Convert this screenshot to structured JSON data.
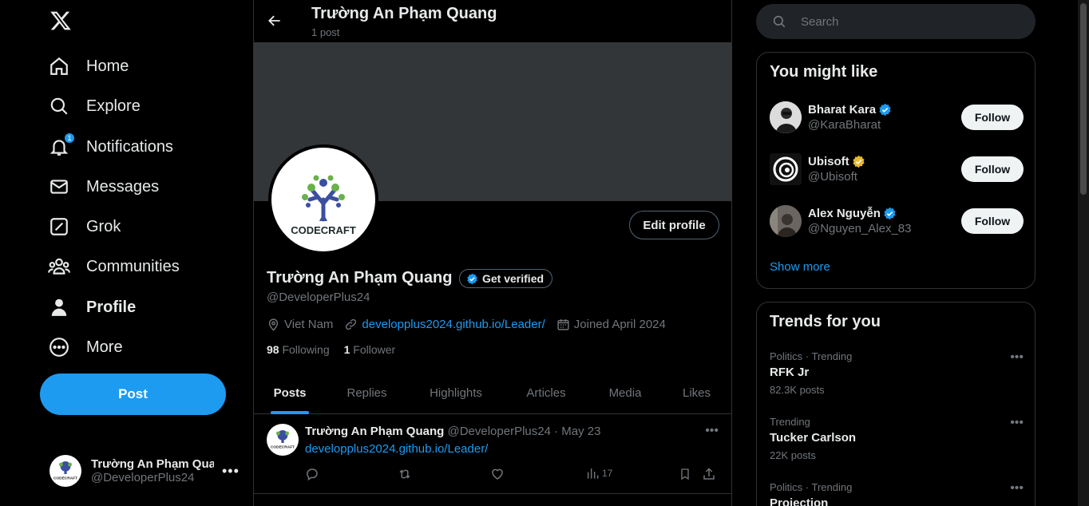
{
  "nav": {
    "items": [
      {
        "label": "Home",
        "icon": "home-icon"
      },
      {
        "label": "Explore",
        "icon": "search-icon"
      },
      {
        "label": "Notifications",
        "icon": "bell-icon",
        "badge": "1"
      },
      {
        "label": "Messages",
        "icon": "envelope-icon"
      },
      {
        "label": "Grok",
        "icon": "grok-icon"
      },
      {
        "label": "Communities",
        "icon": "people-icon"
      },
      {
        "label": "Profile",
        "icon": "person-icon"
      },
      {
        "label": "More",
        "icon": "more-circle-icon"
      }
    ],
    "post_label": "Post",
    "account": {
      "name": "Trường An Phạm Qua",
      "handle": "@DeveloperPlus24"
    }
  },
  "header": {
    "title": "Trường An Phạm Quang",
    "subtitle": "1 post"
  },
  "profile": {
    "edit_label": "Edit profile",
    "name": "Trường An Phạm Quang",
    "get_verified": "Get verified",
    "handle": "@DeveloperPlus24",
    "location": "Viet Nam",
    "website": "developplus2024.github.io/Leader/",
    "joined": "Joined April 2024",
    "following_count": "98",
    "following_label": "Following",
    "followers_count": "1",
    "followers_label": "Follower",
    "logo_text": "CODECRAFT"
  },
  "tabs": [
    "Posts",
    "Replies",
    "Highlights",
    "Articles",
    "Media",
    "Likes"
  ],
  "tweet": {
    "name": "Trường An Phạm Quang",
    "handle_date": "@DeveloperPlus24 · May 23",
    "link": "developplus2024.github.io/Leader/",
    "views": "17"
  },
  "search": {
    "placeholder": "Search"
  },
  "suggestions": {
    "title": "You might like",
    "users": [
      {
        "name": "Bharat Kara",
        "handle": "@KaraBharat",
        "verified": "blue"
      },
      {
        "name": "Ubisoft",
        "handle": "@Ubisoft",
        "verified": "gold"
      },
      {
        "name": "Alex Nguyễn",
        "handle": "@Nguyen_Alex_83",
        "verified": "blue"
      }
    ],
    "follow_label": "Follow",
    "show_more": "Show more"
  },
  "trends": {
    "title": "Trends for you",
    "items": [
      {
        "category": "Politics · Trending",
        "name": "RFK Jr",
        "count": "82.3K posts"
      },
      {
        "category": "Trending",
        "name": "Tucker Carlson",
        "count": "22K posts"
      },
      {
        "category": "Politics · Trending",
        "name": "Projection",
        "count": ""
      }
    ]
  },
  "colors": {
    "accent": "#1d9bf0",
    "background": "#000000",
    "gold": "#e8b92f"
  }
}
